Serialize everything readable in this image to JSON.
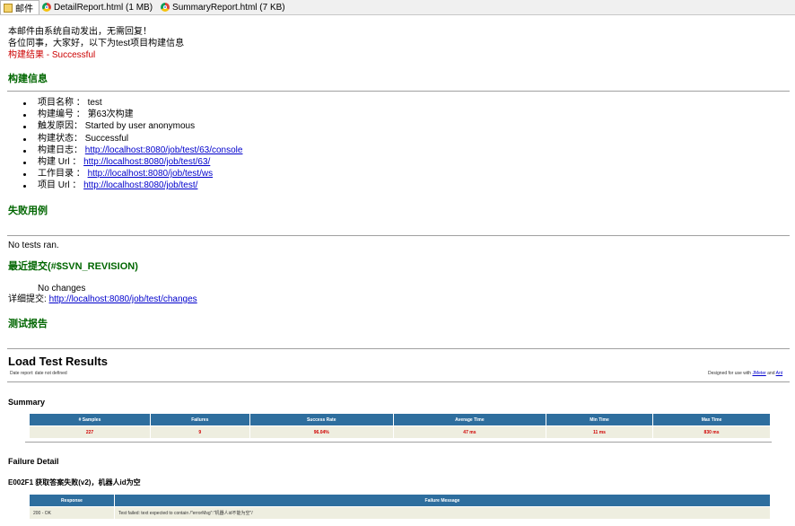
{
  "tabs": [
    {
      "label": "邮件",
      "icon": "mail-icon",
      "active": true
    },
    {
      "label": "DetailReport.html (1 MB)",
      "icon": "chrome-icon",
      "active": false
    },
    {
      "label": "SummaryReport.html (7 KB)",
      "icon": "chrome-icon",
      "active": false
    }
  ],
  "intro": {
    "line1": "本邮件由系统自动发出，无需回复！",
    "line2": "各位同事，大家好，以下为test项目构建信息",
    "result": "构建结果 - Successful"
  },
  "build_info": {
    "heading": "构建信息",
    "items": [
      {
        "label": "项目名称 ： ",
        "value": "test",
        "link": false
      },
      {
        "label": "构建编号 ： ",
        "value": "第63次构建",
        "link": false
      },
      {
        "label": "触发原因： ",
        "value": "Started by user anonymous",
        "link": false
      },
      {
        "label": "构建状态： ",
        "value": "Successful",
        "link": false
      },
      {
        "label": "构建日志： ",
        "value": "http://localhost:8080/job/test/63/console",
        "link": true
      },
      {
        "label": "构建 Url ： ",
        "value": "http://localhost:8080/job/test/63/",
        "link": true
      },
      {
        "label": "工作目录 ： ",
        "value": "http://localhost:8080/job/test/ws",
        "link": true
      },
      {
        "label": "项目 Url ： ",
        "value": "http://localhost:8080/job/test/",
        "link": true
      }
    ]
  },
  "failed_cases": {
    "heading": "失败用例",
    "text": "No tests ran."
  },
  "recent_commits": {
    "heading": "最近提交(#$SVN_REVISION)",
    "changes": "No changes",
    "detail_label": "详细提交: ",
    "detail_link": "http://localhost:8080/job/test/changes"
  },
  "test_report": {
    "heading": "测试报告"
  },
  "load_test": {
    "title": "Load Test Results",
    "date_report": "Date report:  date not defined",
    "designed_prefix": "Designed for use with ",
    "jmeter": "JMeter",
    "and": " and ",
    "ant": "Ant",
    "summary_heading": "Summary",
    "summary_headers": [
      "# Samples",
      "Failures",
      "Success Rate",
      "Average Time",
      "Min Time",
      "Max Time"
    ],
    "summary_values": [
      "227",
      "9",
      "96.04%",
      "47 ms",
      "11 ms",
      "830 ms"
    ],
    "failure_detail_heading": "Failure Detail",
    "failure_item": "E002F1 获取答案失败(v2)，机器人id为空",
    "failure_headers": [
      "Response",
      "Failure Message"
    ],
    "failure_row": [
      "200 - OK",
      "Test failed: text expected to contain /\"errorMsg\":\"机器人id不能为空\"/"
    ]
  }
}
